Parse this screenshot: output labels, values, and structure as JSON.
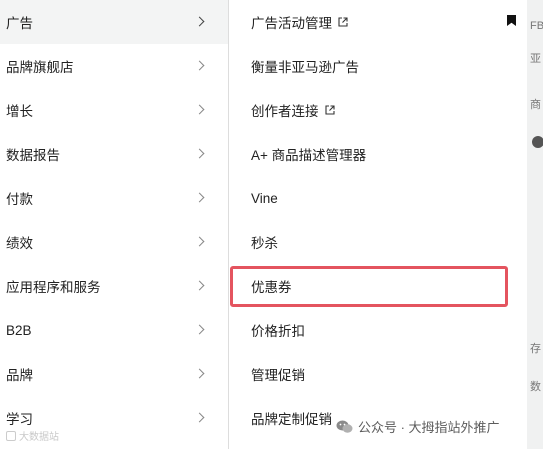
{
  "left_menu": {
    "items": [
      {
        "label": "广告",
        "active": true
      },
      {
        "label": "品牌旗舰店"
      },
      {
        "label": "增长"
      },
      {
        "label": "数据报告"
      },
      {
        "label": "付款"
      },
      {
        "label": "绩效"
      },
      {
        "label": "应用程序和服务"
      },
      {
        "label": "B2B"
      },
      {
        "label": "品牌"
      },
      {
        "label": "学习"
      }
    ]
  },
  "sub_menu": {
    "items": [
      {
        "label": "广告活动管理",
        "icon": "external-link-icon"
      },
      {
        "label": "衡量非亚马逊广告"
      },
      {
        "label": "创作者连接",
        "icon": "external-link-icon"
      },
      {
        "label": "A+ 商品描述管理器"
      },
      {
        "label": "Vine"
      },
      {
        "label": "秒杀"
      },
      {
        "label": "优惠券",
        "highlighted": true
      },
      {
        "label": "价格折扣"
      },
      {
        "label": "管理促销"
      },
      {
        "label": "品牌定制促销"
      }
    ]
  },
  "background_fragments": [
    "FB",
    "亚",
    "商",
    "存",
    "数"
  ],
  "watermark": {
    "left": "大数据站",
    "right": "公众号 · 大拇指站外推广"
  },
  "colors": {
    "highlight_border": "#e4545f",
    "active_item_bg": "#f3f4f4"
  }
}
